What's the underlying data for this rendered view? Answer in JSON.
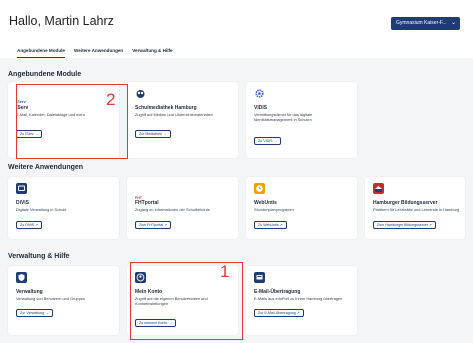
{
  "header": {
    "greeting": "Hallo, Martin Lahrz",
    "school_select": "Gymnasium Kaiser-F...",
    "chevron": "⌄"
  },
  "tabs": [
    "Angebundene Module",
    "Weitere Anwendungen",
    "Verwaltung & Hilfe"
  ],
  "sections": {
    "angebunden": "Angebundene Module",
    "weitere": "Weitere Anwendungen",
    "verwaltung": "Verwaltung & Hilfe"
  },
  "cards": {
    "iserv": {
      "logo": "IServ",
      "title": "IServ",
      "desc": "E-Mail, Kalender, Dateiablage und mehr",
      "button": "Zu IServ →"
    },
    "schulmediathek": {
      "title": "Schulmediathek Hamburg",
      "desc": "Zugriff auf Medien und Unterrichtsmaterialien",
      "button": "Zur Mediathek →"
    },
    "vidis": {
      "title": "VIDIS",
      "desc": "Vermittlungsdienst für das digitale Identitätsmanagement in Schulen",
      "button": "Zu VIDIS →"
    },
    "divis": {
      "title": "DiViS",
      "desc": "Digitale Verwaltung in Schule",
      "button": "Zu DiViS ↗"
    },
    "fhtportal": {
      "logo": "FHT",
      "title": "FHTportal",
      "desc": "Zugang zu Informationen der Schulbehörde",
      "button": "Zum FHTportal ↗"
    },
    "webuntis": {
      "title": "WebUntis",
      "desc": "Stundenplanprogramm",
      "button": "Zu WebUntis ↗"
    },
    "bildungsserver": {
      "title": "Hamburger Bildungsserver",
      "desc": "Plattform für Lehrkräfte und Lernende in Hamburg",
      "button": "Zum Hamburger Bildungsserver ↗"
    },
    "verwaltung": {
      "title": "Verwaltung",
      "desc": "Verwaltung von Benutzern und Gruppen",
      "button": "Zur Verwaltung →"
    },
    "meinkonto": {
      "title": "Mein Konto",
      "desc": "Zugriff auf die eigenen Benutzerdaten und Kontoeinstellungen",
      "button": "Zu meinem Konto →"
    },
    "email": {
      "title": "E-Mail-Übertragung",
      "desc": "E-Mails aus eduPort zu Ihrem Hamburg übertragen",
      "button": "Zur E-Mail-Übertragung ↗"
    }
  },
  "annotations": {
    "one": "1",
    "two": "2",
    "color": "#e53935"
  },
  "colors": {
    "brand": "#1f3c73",
    "background": "#f4f5f7"
  }
}
